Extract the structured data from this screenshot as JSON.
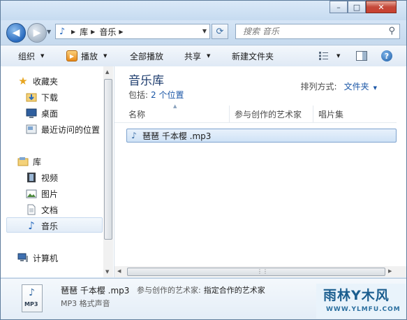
{
  "window": {
    "caption_buttons": {
      "minimize": "–",
      "maximize": "□",
      "close": "✕"
    }
  },
  "nav": {
    "back_glyph": "◀",
    "forward_glyph": "▶",
    "address_crumbs": [
      "库",
      "音乐"
    ],
    "search_placeholder": "搜索 音乐"
  },
  "toolbar": {
    "organize": "组织",
    "play": "播放",
    "play_all": "全部播放",
    "share": "共享",
    "new_folder": "新建文件夹"
  },
  "sidebar": {
    "favorites": {
      "label": "收藏夹",
      "items": [
        "下载",
        "桌面",
        "最近访问的位置"
      ]
    },
    "libraries": {
      "label": "库",
      "items": [
        "视频",
        "图片",
        "文档",
        "音乐"
      ]
    },
    "computer": "计算机",
    "selected": "音乐"
  },
  "content": {
    "title": "音乐库",
    "includes_label": "包括:",
    "includes_link": "2 个位置",
    "arrange_label": "排列方式:",
    "arrange_value": "文件夹",
    "columns": [
      "名称",
      "参与创作的艺术家",
      "唱片集"
    ],
    "files": [
      {
        "name": "琶琶 千本樱 .mp3"
      }
    ]
  },
  "details": {
    "file_name": "琶琶 千本樱 .mp3",
    "artist_label": "参与创作的艺术家:",
    "artist_value": "指定合作的艺术家",
    "file_type": "MP3 格式声音",
    "icon_tag": "MP3"
  },
  "watermark": {
    "title": "雨林Y木风",
    "url": "WWW.YLMFU.COM"
  },
  "colors": {
    "accent": "#1a56a6",
    "library_title": "#1e3d6e",
    "selection": "#cfe2f6"
  }
}
